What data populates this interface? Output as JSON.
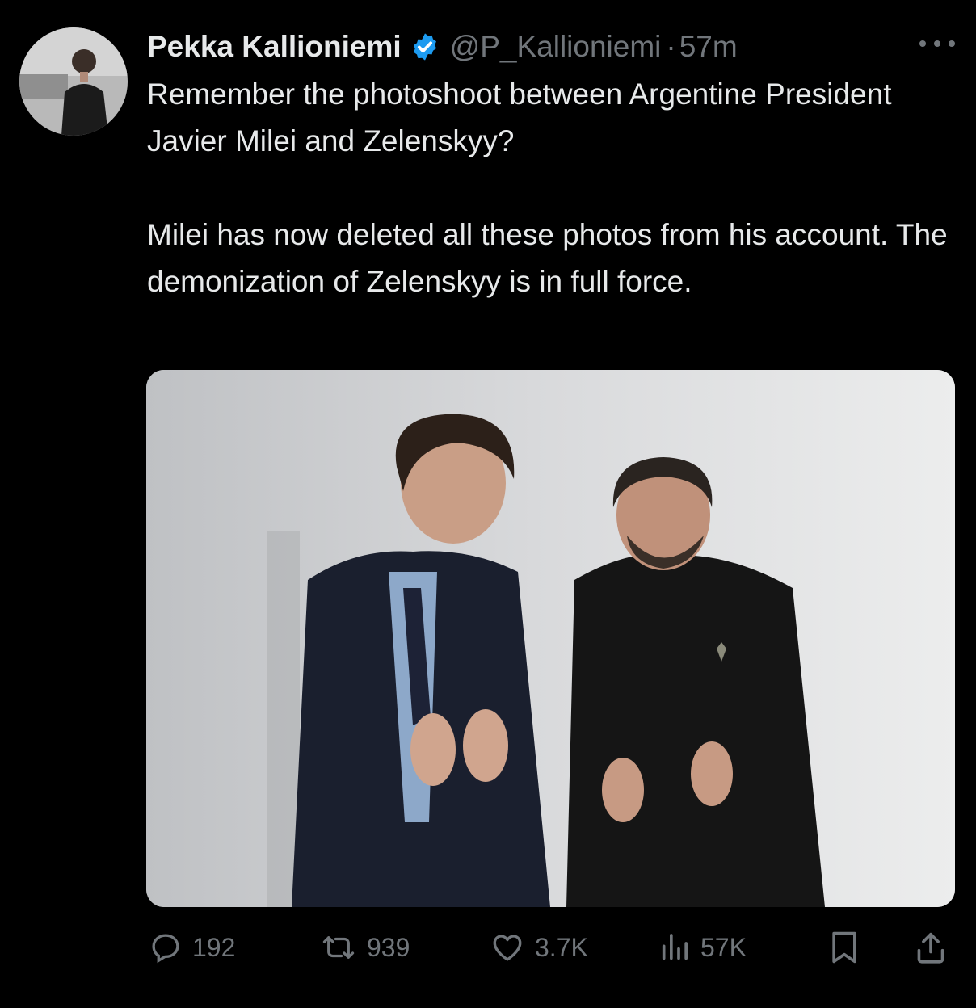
{
  "user": {
    "display_name": "Pekka Kallioniemi",
    "handle": "@P_Kallioniemi",
    "separator": "·",
    "timestamp": "57m"
  },
  "tweet": {
    "paragraphs": [
      "Remember the photoshoot between Argentine President Javier Milei and Zelenskyy?",
      "Milei has now deleted all these photos from his account. The demonization of Zelenskyy is in full force."
    ]
  },
  "actions": {
    "replies": "192",
    "reposts": "939",
    "likes": "3.7K",
    "views": "57K"
  },
  "icons": [
    "verified-badge-icon",
    "more-icon",
    "reply-icon",
    "repost-icon",
    "like-icon",
    "views-icon",
    "bookmark-icon",
    "share-icon"
  ],
  "colors": {
    "background": "#000000",
    "text": "#e7e9ea",
    "secondary": "#71767b",
    "verified": "#1d9bf0"
  }
}
